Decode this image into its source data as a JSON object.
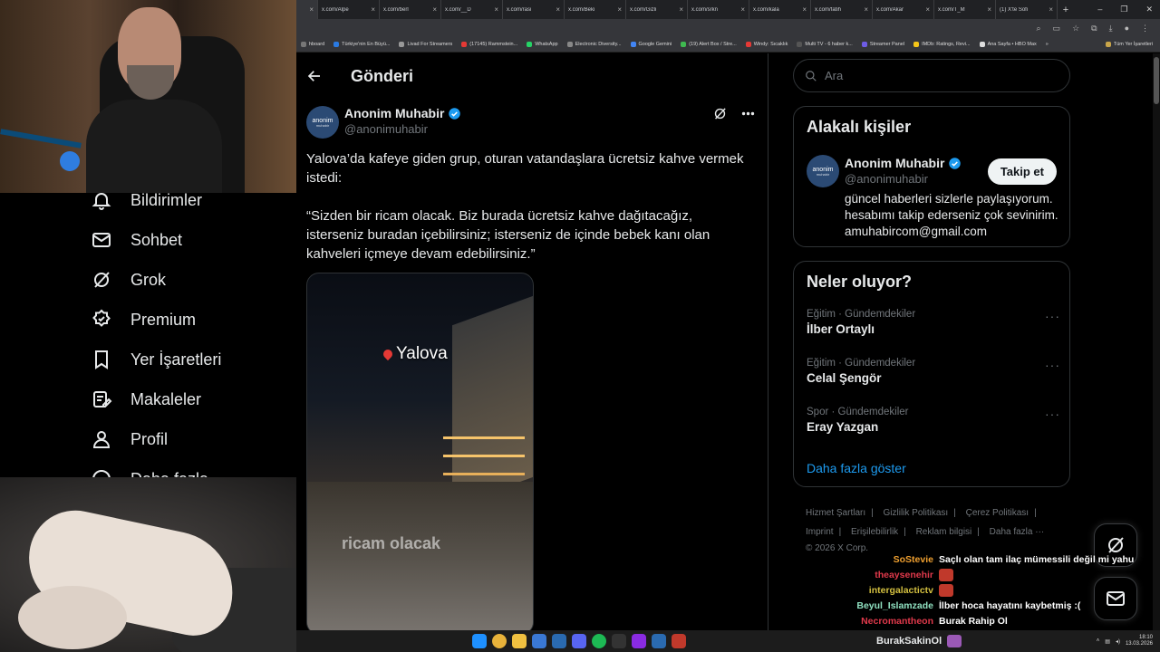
{
  "browser": {
    "tabs": [
      {
        "label": "",
        "active": true
      },
      {
        "label": "x.com/Alpe"
      },
      {
        "label": "x.com/berl"
      },
      {
        "label": "x.com/__D"
      },
      {
        "label": "x.com/rasi"
      },
      {
        "label": "x.com/Beki"
      },
      {
        "label": "x.com/Gizli"
      },
      {
        "label": "x.com/srkn"
      },
      {
        "label": "x.com/kala"
      },
      {
        "label": "x.com/fatih"
      },
      {
        "label": "x.com/Akar"
      },
      {
        "label": "x.com/T_M"
      },
      {
        "label": "(1) X'te Sofi"
      }
    ],
    "new_tab": "+",
    "bookmarks": [
      {
        "label": "hboard",
        "color": "#777"
      },
      {
        "label": "Türkiye'nin En Büyü...",
        "color": "#2a7ae2"
      },
      {
        "label": "Livad For Streamers",
        "color": "#999"
      },
      {
        "label": "(17145) Rammstein...",
        "color": "#e53935"
      },
      {
        "label": "WhatsApp",
        "color": "#25d366"
      },
      {
        "label": "Electronic Diversity...",
        "color": "#888"
      },
      {
        "label": "Google Gemini",
        "color": "#4285f4"
      },
      {
        "label": "(19) Alert Box / Stre...",
        "color": "#3fb950"
      },
      {
        "label": "Windy: Sıcaklık",
        "color": "#e53935"
      },
      {
        "label": "Multi TV - 6 haber k...",
        "color": "#555"
      },
      {
        "label": "Streamer Panel",
        "color": "#6e5ce6"
      },
      {
        "label": "IMDb: Ratings, Revi...",
        "color": "#f5c518"
      },
      {
        "label": "Ana Sayfa • HBO Max",
        "color": "#ddd"
      }
    ],
    "bookmarks_more": "»",
    "all_bookmarks": "Tüm Yer İşaretleri"
  },
  "nav": {
    "items": [
      {
        "label": "Bildirimler",
        "icon": "bell-icon"
      },
      {
        "label": "Sohbet",
        "icon": "envelope-icon"
      },
      {
        "label": "Grok",
        "icon": "grok-icon"
      },
      {
        "label": "Premium",
        "icon": "premium-icon"
      },
      {
        "label": "Yer İşaretleri",
        "icon": "bookmark-icon"
      },
      {
        "label": "Makaleler",
        "icon": "article-icon"
      },
      {
        "label": "Profil",
        "icon": "profile-icon"
      },
      {
        "label": "Daha fazla",
        "icon": "more-circle-icon"
      }
    ]
  },
  "header": {
    "title": "Gönderi"
  },
  "post": {
    "display_name": "Anonim Muhabir",
    "handle": "@anonimuhabir",
    "avatar_text": "anonim",
    "avatar_sub": "muhabir",
    "text_1": "Yalova’da kafeye giden grup, oturan vatandaşlara ücretsiz kahve vermek istedi:",
    "text_2": "“Sizden bir ricam olacak. Biz burada ücretsiz kahve dağıtacağız, isterseniz buradan içebilirsiniz; isterseniz de içinde bebek kanı olan kahveleri içmeye devam edebilirsiniz.”",
    "video_location": "Yalova",
    "video_caption": "ricam olacak"
  },
  "search": {
    "placeholder": "Ara"
  },
  "related": {
    "title": "Alakalı kişiler",
    "name": "Anonim Muhabir",
    "handle": "@anonimuhabir",
    "avatar_text": "anonim",
    "avatar_sub": "muhabir",
    "follow_label": "Takip et",
    "bio": "güncel haberleri sizlerle paylaşıyorum. hesabımı takip ederseniz çok sevinirim. amuhabircom@gmail.com"
  },
  "trends": {
    "title": "Neler oluyor?",
    "items": [
      {
        "category": "Eğitim · Gündemdekiler",
        "name": "İlber Ortaylı"
      },
      {
        "category": "Eğitim · Gündemdekiler",
        "name": "Celal Şengör"
      },
      {
        "category": "Spor · Gündemdekiler",
        "name": "Eray Yazgan"
      }
    ],
    "more_glyph": "···",
    "show_more": "Daha fazla göster"
  },
  "footer": {
    "links": [
      "Hizmet Şartları",
      "Gizlilik Politikası",
      "Çerez Politikası",
      "Imprint",
      "Erişilebilirlik",
      "Reklam bilgisi",
      "Daha fazla ···"
    ],
    "copyright": "© 2026 X Corp."
  },
  "chat": [
    {
      "user": "SoStevie",
      "color": "#f0a030",
      "message": "Saçlı olan tam ilaç mümessili değil mi yahu"
    },
    {
      "user": "theaysenehir",
      "color": "#e0394b",
      "message": ""
    },
    {
      "user": "intergalactictv",
      "color": "#d4c040",
      "message": ""
    },
    {
      "user": "Beyul_Islamzade",
      "color": "#8fe0c0",
      "message": "İlber hoca hayatını kaybetmiş :("
    },
    {
      "user": "Necromantheon",
      "color": "#e0394b",
      "message": "Burak Rahip Ol"
    }
  ],
  "taskbar": {
    "user": "BurakSakinOl",
    "time": "18:10",
    "date": "13.03.2026"
  },
  "colors": {
    "accent": "#1d9bf0",
    "background": "#000000",
    "border": "#2f3336",
    "muted": "#71767b"
  }
}
